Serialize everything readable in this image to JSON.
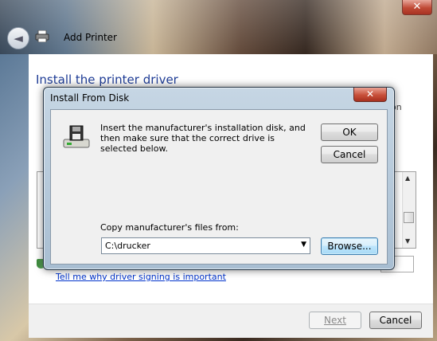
{
  "wizard": {
    "title": "Add Printer",
    "close_glyph": "✕",
    "back_glyph": "◄",
    "heading": "Install the printer driver",
    "bg_fragment_right": "ion",
    "sign_link": "Tell me why driver signing is important",
    "next_label": "Next",
    "cancel_label": "Cancel"
  },
  "dialog": {
    "title": "Install From Disk",
    "close_glyph": "✕",
    "message": "Insert the manufacturer's installation disk, and then make sure that the correct drive is selected below.",
    "ok_label": "OK",
    "cancel_label": "Cancel",
    "copy_label": "Copy manufacturer's files from:",
    "path_value": "C:\\drucker",
    "dropdown_glyph": "▼",
    "browse_label": "Browse..."
  },
  "icons": {
    "printer": "printer-icon",
    "disk": "floppy-disk-icon",
    "shield": "shield-icon"
  },
  "colors": {
    "heading": "#1e3c96",
    "link": "#0033cc",
    "close_red": "#c04a36"
  }
}
